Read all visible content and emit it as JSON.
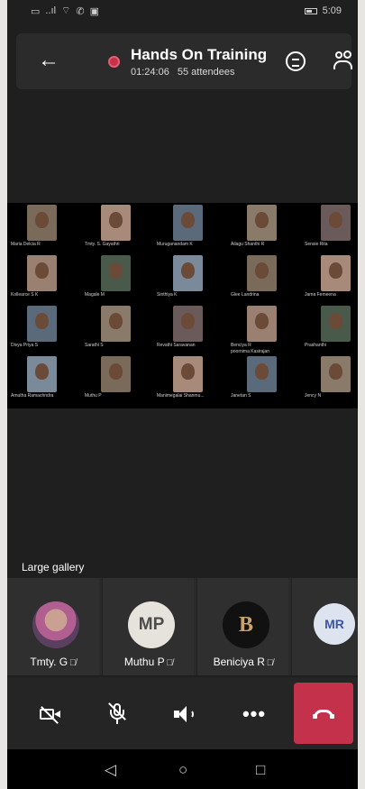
{
  "status_bar": {
    "time": "5:09",
    "signal": "..ıl",
    "icons": [
      "sim-icon",
      "wifi-icon",
      "call-icon",
      "gallery-icon",
      "battery-icon"
    ]
  },
  "header": {
    "title": "Hands On Training",
    "duration": "01:24:06",
    "attendees": "55 attendees",
    "rec_color": "#c4314b"
  },
  "shared_screen": {
    "tiles": [
      {
        "name": "Maria Delcia R"
      },
      {
        "name": "Tmty. S. Gayathri"
      },
      {
        "name": "Muruganandam K"
      },
      {
        "name": "Ailagu Shanthi R"
      },
      {
        "name": "Sensie Rita"
      },
      {
        "name": "Kollearce S K"
      },
      {
        "name": "Magale M"
      },
      {
        "name": "Sinthiya K"
      },
      {
        "name": "Glee Landrina"
      },
      {
        "name": "Jama Femeena"
      },
      {
        "name": "Divya Priya S"
      },
      {
        "name": "Sarathi S"
      },
      {
        "name": "Revathi Saravanan"
      },
      {
        "name": "Benciya R"
      },
      {
        "name": "Prashanthi"
      },
      {
        "name": "Amutha Ramachndra"
      },
      {
        "name": "Muthu P"
      },
      {
        "name": "Manimegalai Shanmu..."
      },
      {
        "name": "Janetan S"
      },
      {
        "name": "Jency N"
      }
    ],
    "extra_name": "poornima Kasirajan"
  },
  "gallery": {
    "label": "Large gallery",
    "participants": [
      {
        "name": "Tmty. G",
        "initials": ""
      },
      {
        "name": "Muthu P",
        "initials": "MP"
      },
      {
        "name": "Beniciya R",
        "initials": "B"
      },
      {
        "name": "",
        "initials": "MR"
      }
    ]
  },
  "controls": {
    "more_label": "•••"
  },
  "navbar": {
    "back": "◁",
    "home": "○",
    "recent": "□"
  }
}
